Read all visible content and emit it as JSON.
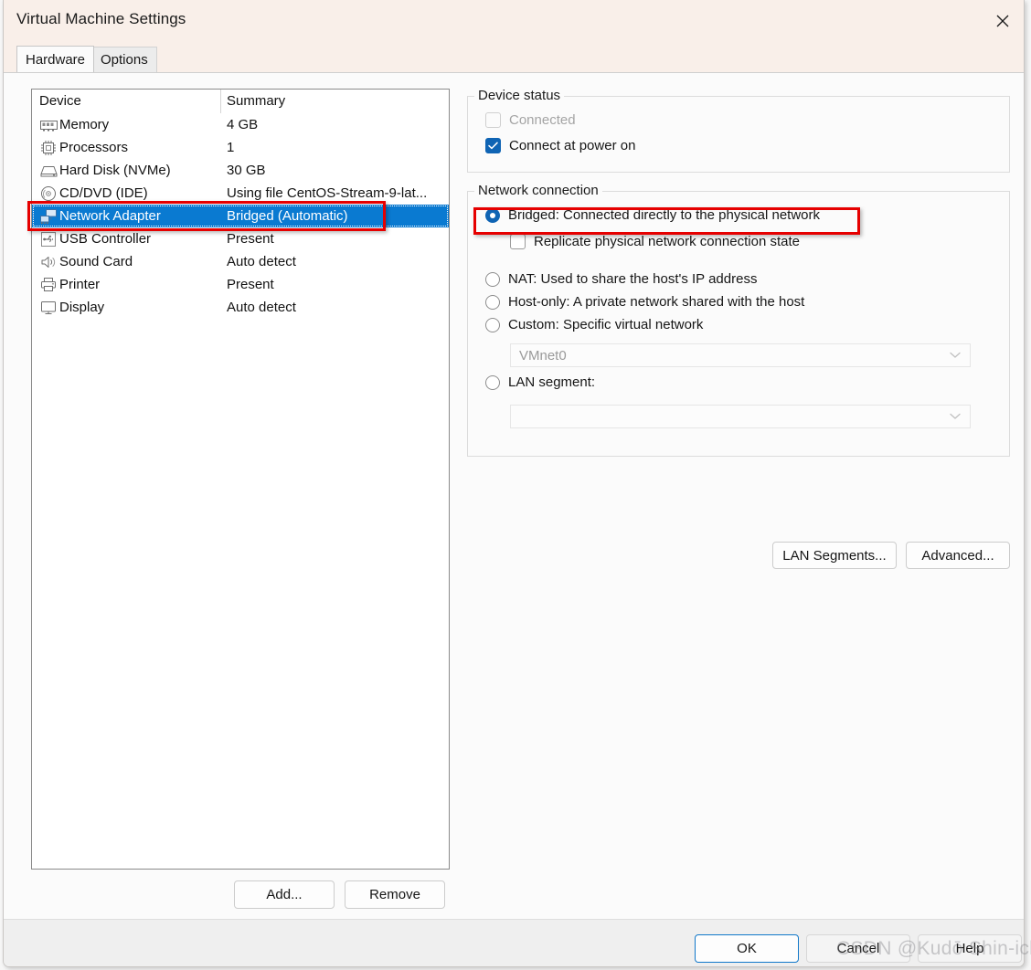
{
  "window": {
    "title": "Virtual Machine Settings",
    "close_icon": "close-icon"
  },
  "tabs": [
    {
      "label": "Hardware",
      "active": true
    },
    {
      "label": "Options",
      "active": false
    }
  ],
  "device_list": {
    "columns": [
      "Device",
      "Summary"
    ],
    "rows": [
      {
        "icon": "memory-icon",
        "device": "Memory",
        "summary": "4 GB",
        "selected": false
      },
      {
        "icon": "processor-icon",
        "device": "Processors",
        "summary": "1",
        "selected": false
      },
      {
        "icon": "hard-disk-icon",
        "device": "Hard Disk (NVMe)",
        "summary": "30 GB",
        "selected": false
      },
      {
        "icon": "cd-dvd-icon",
        "device": "CD/DVD (IDE)",
        "summary": "Using file CentOS-Stream-9-lat...",
        "selected": false
      },
      {
        "icon": "network-adapter-icon",
        "device": "Network Adapter",
        "summary": "Bridged (Automatic)",
        "selected": true
      },
      {
        "icon": "usb-controller-icon",
        "device": "USB Controller",
        "summary": "Present",
        "selected": false
      },
      {
        "icon": "sound-card-icon",
        "device": "Sound Card",
        "summary": "Auto detect",
        "selected": false
      },
      {
        "icon": "printer-icon",
        "device": "Printer",
        "summary": "Present",
        "selected": false
      },
      {
        "icon": "display-icon",
        "device": "Display",
        "summary": "Auto detect",
        "selected": false
      }
    ],
    "buttons": {
      "add": "Add...",
      "remove": "Remove"
    }
  },
  "device_status": {
    "legend": "Device status",
    "connected": {
      "label": "Connected",
      "checked": false,
      "disabled": true
    },
    "connect_at_power_on": {
      "label": "Connect at power on",
      "checked": true,
      "disabled": false
    }
  },
  "network_connection": {
    "legend": "Network connection",
    "options": [
      {
        "label": "Bridged: Connected directly to the physical network",
        "selected": true
      },
      {
        "label": "NAT: Used to share the host's IP address",
        "selected": false
      },
      {
        "label": "Host-only: A private network shared with the host",
        "selected": false
      },
      {
        "label": "Custom: Specific virtual network",
        "selected": false
      },
      {
        "label": "LAN segment:",
        "selected": false
      }
    ],
    "replicate_state": {
      "label": "Replicate physical network connection state",
      "checked": false
    },
    "custom_network_value": "VMnet0",
    "lan_segment_value": "",
    "buttons": {
      "lan_segments": "LAN Segments...",
      "advanced": "Advanced..."
    }
  },
  "footer": {
    "ok": "OK",
    "cancel": "Cancel",
    "help": "Help"
  },
  "watermark": {
    "text": "CSDN @Kudō Shin-ichi"
  },
  "colors": {
    "titlebar": "#f9efe9",
    "selection_blue": "#0a7ad1",
    "accent_blue": "#0f64b4",
    "annotation_red": "#e60000",
    "footer_bg": "#efefef"
  }
}
